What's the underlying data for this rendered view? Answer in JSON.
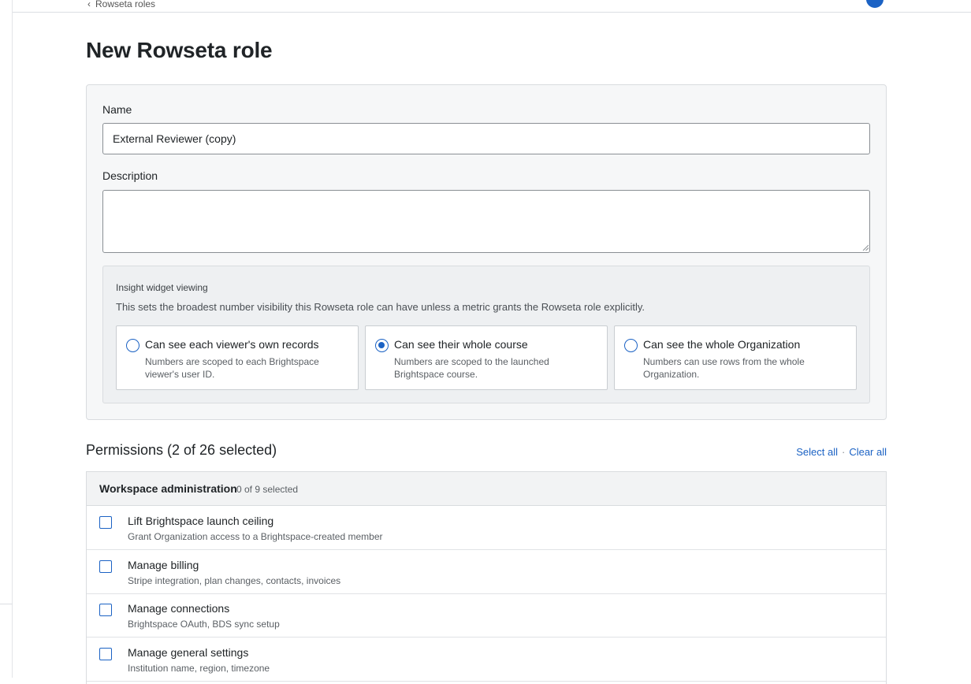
{
  "breadcrumb": {
    "text": "Rowseta roles"
  },
  "page": {
    "title": "New Rowseta role"
  },
  "form": {
    "name_label": "Name",
    "name_value": "External Reviewer (copy)",
    "description_label": "Description",
    "description_value": ""
  },
  "insight": {
    "title": "Insight widget viewing",
    "description": "This sets the broadest number visibility this Rowseta role can have unless a metric grants the Rowseta role explicitly.",
    "options": [
      {
        "title": "Can see each viewer's own records",
        "description": "Numbers are scoped to each Brightspace viewer's user ID.",
        "selected": false
      },
      {
        "title": "Can see their whole course",
        "description": "Numbers are scoped to the launched Brightspace course.",
        "selected": true
      },
      {
        "title": "Can see the whole Organization",
        "description": "Numbers can use rows from the whole Organization.",
        "selected": false
      }
    ]
  },
  "permissions": {
    "title": "Permissions (2 of 26 selected)",
    "select_all": "Select all",
    "separator": "·",
    "clear_all": "Clear all",
    "group": {
      "name": "Workspace administration",
      "count": "0 of 9 selected"
    },
    "rows": [
      {
        "name": "Lift Brightspace launch ceiling",
        "description": "Grant Organization access to a Brightspace-created member",
        "checked": false
      },
      {
        "name": "Manage billing",
        "description": "Stripe integration, plan changes, contacts, invoices",
        "checked": false
      },
      {
        "name": "Manage connections",
        "description": "Brightspace OAuth, BDS sync setup",
        "checked": false
      },
      {
        "name": "Manage general settings",
        "description": "Institution name, region, timezone",
        "checked": false
      }
    ]
  },
  "colors": {
    "accent": "#1b62c4",
    "card_bg": "#f6f7f8",
    "border": "#d9dcdf"
  }
}
